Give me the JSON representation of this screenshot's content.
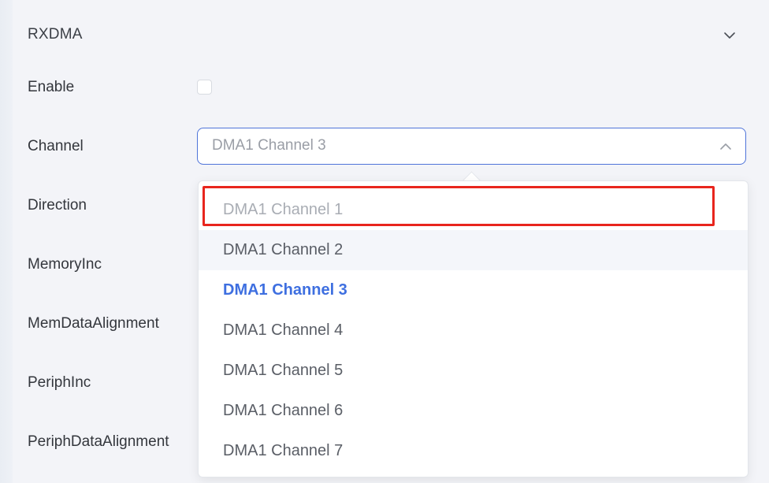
{
  "section": {
    "title": "RXDMA",
    "collapse_icon": "chevron-down-icon"
  },
  "fields": {
    "enable_label": "Enable",
    "enable_checked": false,
    "channel_label": "Channel",
    "direction_label": "Direction",
    "memory_inc_label": "MemoryInc",
    "mem_data_alignment_label": "MemDataAlignment",
    "periph_inc_label": "PeriphInc",
    "periph_data_alignment_label": "PeriphDataAlignment"
  },
  "channel_select": {
    "value": "DMA1 Channel 3",
    "arrow_icon": "chevron-up-icon",
    "options": [
      {
        "label": "DMA1 Channel 1",
        "state": "disabled"
      },
      {
        "label": "DMA1 Channel 2",
        "state": "hovered"
      },
      {
        "label": "DMA1 Channel 3",
        "state": "selected"
      },
      {
        "label": "DMA1 Channel 4",
        "state": "normal"
      },
      {
        "label": "DMA1 Channel 5",
        "state": "normal"
      },
      {
        "label": "DMA1 Channel 6",
        "state": "normal"
      },
      {
        "label": "DMA1 Channel 7",
        "state": "normal"
      }
    ]
  },
  "colors": {
    "accent": "#3e6fe0",
    "select_border": "#4f74d9",
    "highlight": "#e8251d"
  }
}
